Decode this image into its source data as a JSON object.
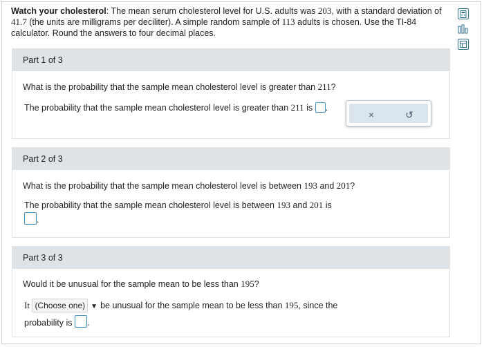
{
  "intro": {
    "title": "Watch your cholesterol",
    "t1": ": The mean serum cholesterol level for U.S. adults was ",
    "n_mean": "203",
    "t2": ", with a standard deviation of",
    "n_sd": "41.7",
    "t3": " (the units are milligrams per deciliter). A simple random sample of ",
    "n_size": "113",
    "t4": " adults is chosen. Use the TI-84",
    "t5": "calculator. Round the answers to four decimal places."
  },
  "tools": {
    "icon1": "calculator-icon",
    "icon2": "bar-chart-icon",
    "icon3": "table-icon"
  },
  "part1": {
    "header": "Part 1 of 3",
    "question_a": "What is the probability that the sample mean cholesterol level is greater than ",
    "question_n": "211",
    "question_b": "?",
    "answer_a": "The probability that the sample mean cholesterol level is greater than ",
    "answer_n": "211",
    "answer_b": " is",
    "period": ".",
    "toolbar_clear": "×",
    "toolbar_undo": "↺"
  },
  "part2": {
    "header": "Part 2 of 3",
    "question_a": "What is the probability that the sample mean cholesterol level is between ",
    "question_n1": "193",
    "question_mid": " and ",
    "question_n2": "201",
    "question_b": "?",
    "answer_a": "The probability that the sample mean cholesterol level is between ",
    "answer_n1": "193",
    "answer_mid": " and ",
    "answer_n2": "201",
    "answer_b": " is",
    "period": "."
  },
  "part3": {
    "header": "Part 3 of 3",
    "question_a": "Would it be unusual for the sample mean to be less than ",
    "question_n": "195",
    "question_b": "?",
    "answer_it": "It",
    "select_value": "(Choose one)",
    "select_arrow": "▼",
    "answer_a": "be unusual for the sample mean to be less than ",
    "answer_n": "195",
    "answer_b": ", since the",
    "answer_c": "probability is",
    "period": "."
  }
}
